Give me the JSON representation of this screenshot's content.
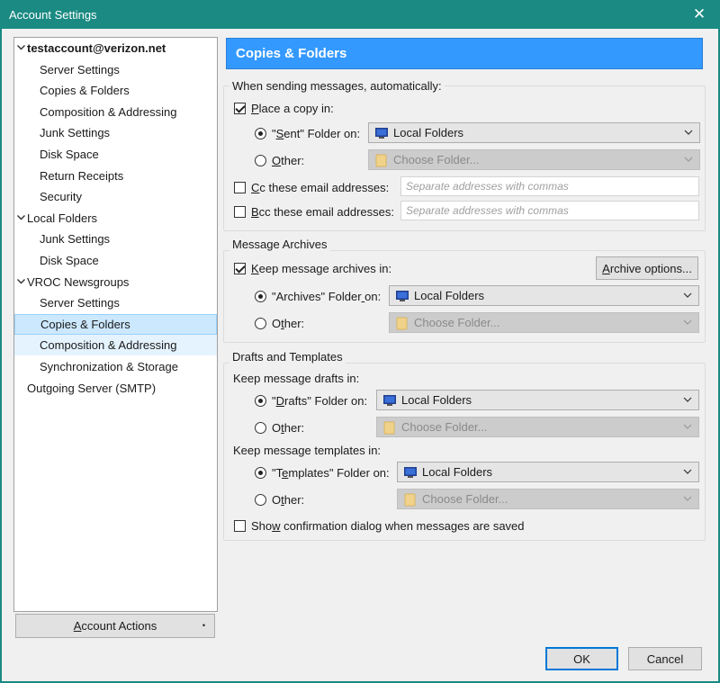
{
  "window": {
    "title": "Account Settings"
  },
  "tree": [
    {
      "label": "testaccount@verizon.net",
      "level": 0,
      "expanded": true,
      "bold": true
    },
    {
      "label": "Server Settings",
      "level": 1
    },
    {
      "label": "Copies & Folders",
      "level": 1
    },
    {
      "label": "Composition & Addressing",
      "level": 1
    },
    {
      "label": "Junk Settings",
      "level": 1
    },
    {
      "label": "Disk Space",
      "level": 1
    },
    {
      "label": "Return Receipts",
      "level": 1
    },
    {
      "label": "Security",
      "level": 1
    },
    {
      "label": "Local Folders",
      "level": 0,
      "expanded": true
    },
    {
      "label": "Junk Settings",
      "level": 1
    },
    {
      "label": "Disk Space",
      "level": 1
    },
    {
      "label": "VROC Newsgroups",
      "level": 0,
      "expanded": true
    },
    {
      "label": "Server Settings",
      "level": 1
    },
    {
      "label": "Copies & Folders",
      "level": 1,
      "selected": true
    },
    {
      "label": "Composition & Addressing",
      "level": 1,
      "hover": true
    },
    {
      "label": "Synchronization & Storage",
      "level": 1
    },
    {
      "label": "Outgoing Server (SMTP)",
      "level": 0
    }
  ],
  "account_actions": {
    "label": "Account Actions",
    "dot": "•"
  },
  "header": {
    "title": "Copies & Folders"
  },
  "sending": {
    "legend": "When sending messages, automatically:",
    "place_copy": {
      "label": "Place a copy in:",
      "checked": true
    },
    "sent_radio": {
      "label": "\"Sent\" Folder on:",
      "checked": true
    },
    "sent_dropdown": "Local Folders",
    "other_radio": {
      "label": "Other:",
      "checked": false
    },
    "other_dropdown": "Choose Folder...",
    "cc": {
      "label": "Cc these email addresses:",
      "checked": false,
      "placeholder": "Separate addresses with commas"
    },
    "bcc": {
      "label": "Bcc these email addresses:",
      "checked": false,
      "placeholder": "Separate addresses with commas"
    }
  },
  "archives": {
    "legend": "Message Archives",
    "keep": {
      "label": "Keep message archives in:",
      "checked": true
    },
    "options_button": "Archive options...",
    "archives_radio": {
      "label": "\"Archives\" Folder on:",
      "checked": true
    },
    "archives_dropdown": "Local Folders",
    "other_radio": {
      "label": "Other:",
      "checked": false
    },
    "other_dropdown": "Choose Folder..."
  },
  "drafts": {
    "legend": "Drafts and Templates",
    "drafts_heading": "Keep message drafts in:",
    "drafts_radio": {
      "label": "\"Drafts\" Folder on:",
      "checked": true
    },
    "drafts_dropdown": "Local Folders",
    "drafts_other_radio": {
      "label": "Other:",
      "checked": false
    },
    "drafts_other_dropdown": "Choose Folder...",
    "templates_heading": "Keep message templates in:",
    "templates_radio": {
      "label": "\"Templates\" Folder on:",
      "checked": true
    },
    "templates_dropdown": "Local Folders",
    "templates_other_radio": {
      "label": "Other:",
      "checked": false
    },
    "templates_other_dropdown": "Choose Folder...",
    "confirm": {
      "label": "Show confirmation dialog when messages are saved",
      "checked": false
    }
  },
  "buttons": {
    "ok": "OK",
    "cancel": "Cancel"
  },
  "icons": {
    "close": "close-icon",
    "computer": "computer-icon",
    "folder": "folder-icon",
    "chevron": "chevron-down-icon",
    "twisty": "expanded-twisty-icon"
  },
  "colors": {
    "titlebar": "#1a8a82",
    "banner": "#3399ff",
    "selected": "#cce8ff"
  }
}
